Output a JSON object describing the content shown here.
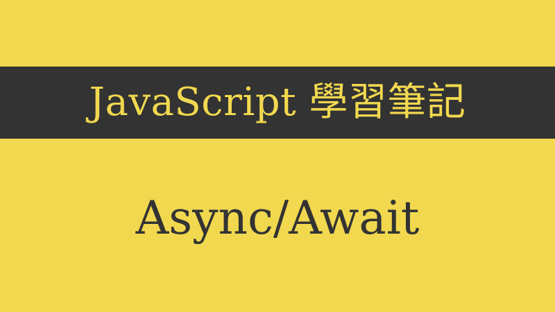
{
  "banner": {
    "title": "JavaScript 學習筆記",
    "background_color": "#333333",
    "text_color": "#f1d84f"
  },
  "subtitle": {
    "text": "Async/Await",
    "text_color": "#333333"
  },
  "page": {
    "background_color": "#f1d84f"
  }
}
